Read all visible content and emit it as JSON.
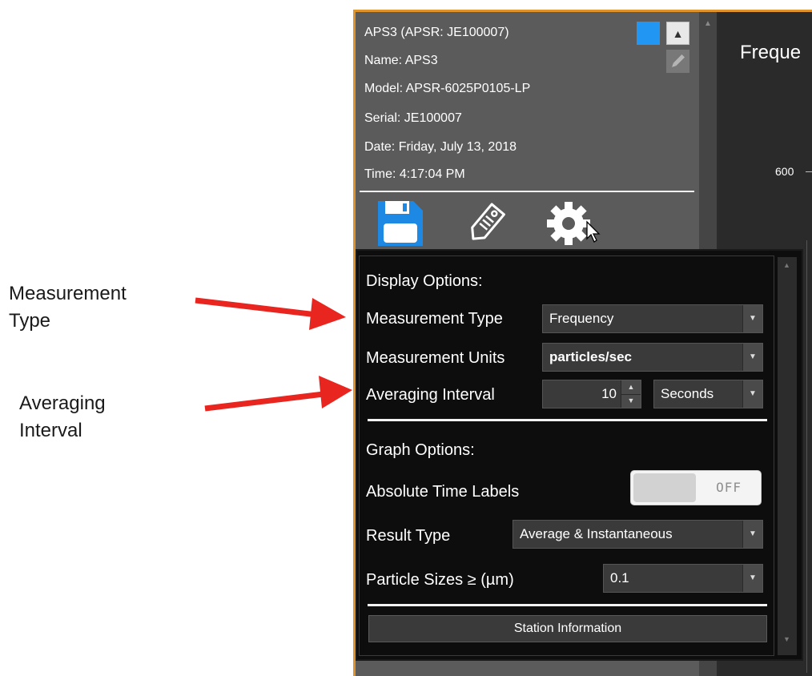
{
  "annotations": {
    "measurement_type_line1": "Measurement",
    "measurement_type_line2": "Type",
    "averaging_interval_line1": "Averaging",
    "averaging_interval_line2": "Interval",
    "arrow_color": "#e8251f"
  },
  "station": {
    "header": "APS3 (APSR: JE100007)",
    "name": "Name:  APS3",
    "model": "Model: APSR-6025P0105-LP",
    "serial": "Serial:  JE100007",
    "date": "Date:   Friday, July 13, 2018",
    "time": "Time:   4:17:04 PM",
    "swatch_color": "#2196f3"
  },
  "toolbar": {
    "icons": [
      "save-icon",
      "tag-icon",
      "gear-icon"
    ]
  },
  "graph": {
    "title": "Freque",
    "tick_600": "600"
  },
  "display_options": {
    "heading": "Display Options:",
    "measurement_type_label": "Measurement Type",
    "measurement_type_value": "Frequency",
    "measurement_units_label": "Measurement Units",
    "measurement_units_value": "particles/sec",
    "averaging_interval_label": "Averaging Interval",
    "averaging_interval_value": "10",
    "averaging_interval_unit": "Seconds"
  },
  "graph_options": {
    "heading": "Graph Options:",
    "absolute_time_label": "Absolute Time Labels",
    "absolute_time_toggle": "OFF",
    "result_type_label": "Result Type",
    "result_type_value": "Average & Instantaneous",
    "particle_sizes_label": "Particle Sizes ≥ (µm)",
    "particle_sizes_value": "0.1"
  },
  "footer": {
    "station_information_button": "Station Information"
  }
}
